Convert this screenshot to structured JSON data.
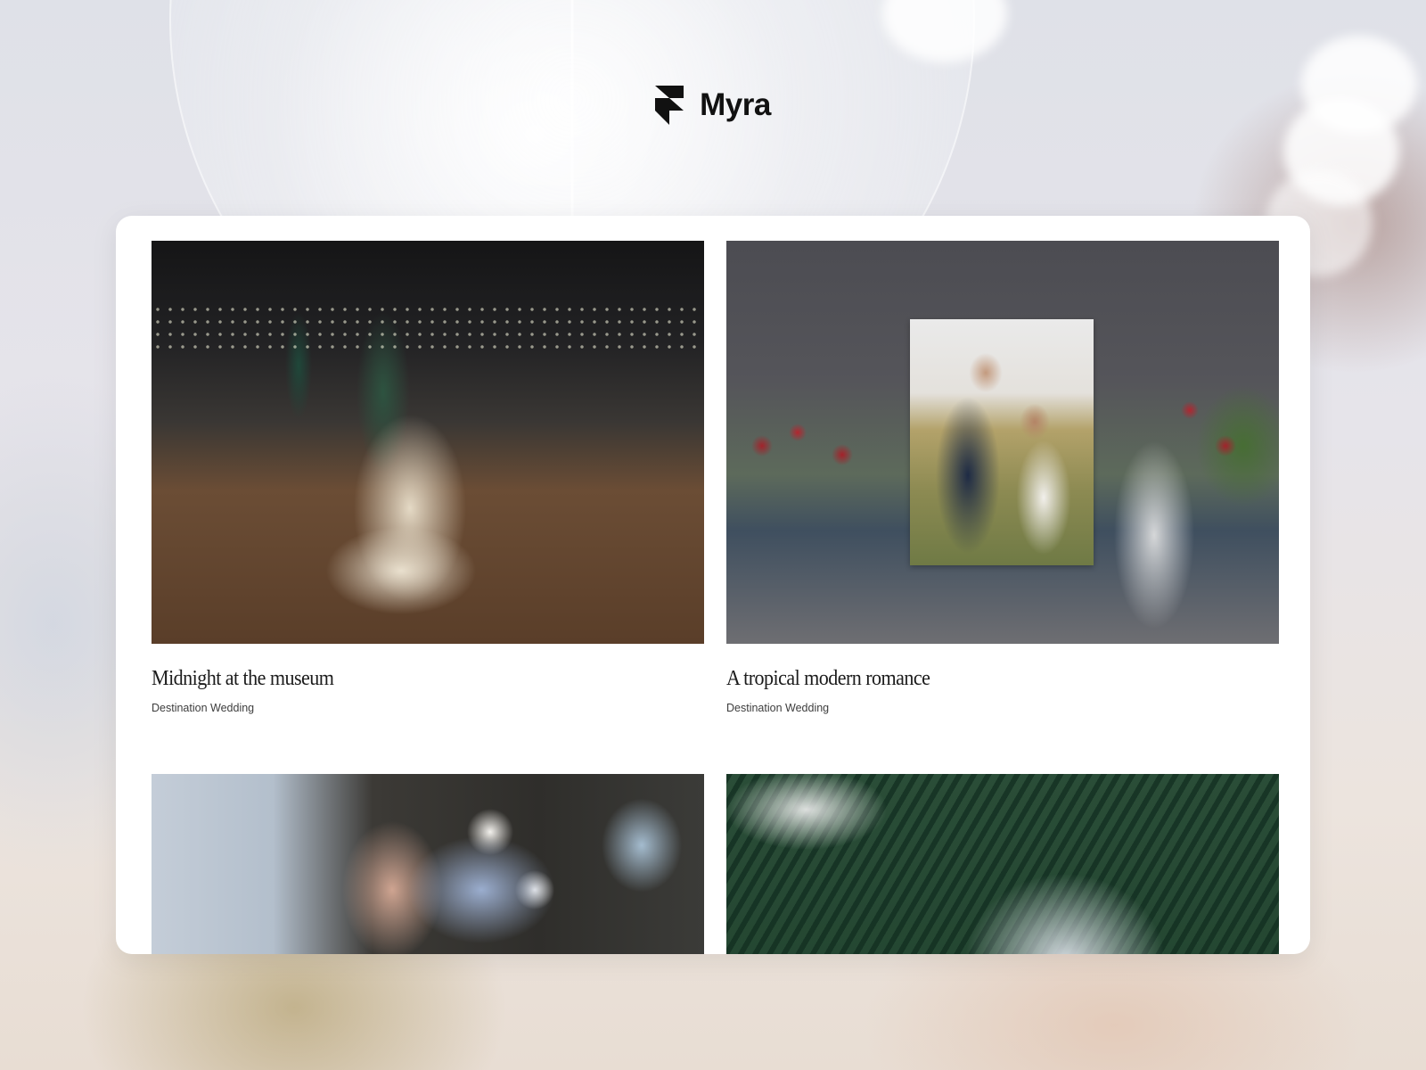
{
  "brand": {
    "name": "Myra",
    "logo_icon": "framer-logo-icon"
  },
  "projects": [
    {
      "title": "Midnight at the museum",
      "category": "Destination Wedding",
      "image": "bride-groom-dance-photo"
    },
    {
      "title": "A tropical modern romance",
      "category": "Destination Wedding",
      "image": "poolside-wedding-photo"
    },
    {
      "title": "",
      "category": "",
      "image": "hands-bouquet-photo"
    },
    {
      "title": "",
      "category": "",
      "image": "palm-leaves-photo"
    }
  ],
  "colors": {
    "panel": "#ffffff",
    "text": "#1c1c1c",
    "subtext": "#3d3d3d"
  }
}
